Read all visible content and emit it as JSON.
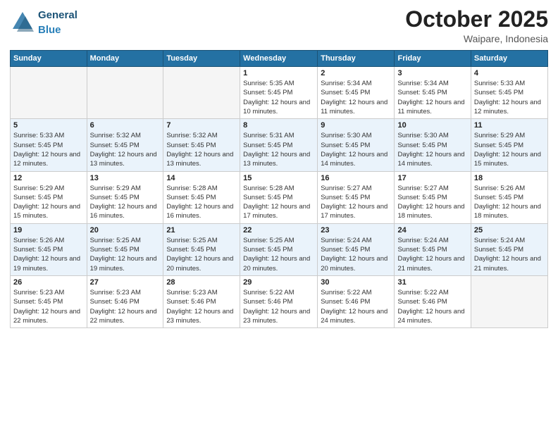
{
  "logo": {
    "general": "General",
    "blue": "Blue"
  },
  "header": {
    "month": "October 2025",
    "location": "Waipare, Indonesia"
  },
  "weekdays": [
    "Sunday",
    "Monday",
    "Tuesday",
    "Wednesday",
    "Thursday",
    "Friday",
    "Saturday"
  ],
  "weeks": [
    [
      {
        "day": "",
        "sunrise": "",
        "sunset": "",
        "daylight": ""
      },
      {
        "day": "",
        "sunrise": "",
        "sunset": "",
        "daylight": ""
      },
      {
        "day": "",
        "sunrise": "",
        "sunset": "",
        "daylight": ""
      },
      {
        "day": "1",
        "sunrise": "Sunrise: 5:35 AM",
        "sunset": "Sunset: 5:45 PM",
        "daylight": "Daylight: 12 hours and 10 minutes."
      },
      {
        "day": "2",
        "sunrise": "Sunrise: 5:34 AM",
        "sunset": "Sunset: 5:45 PM",
        "daylight": "Daylight: 12 hours and 11 minutes."
      },
      {
        "day": "3",
        "sunrise": "Sunrise: 5:34 AM",
        "sunset": "Sunset: 5:45 PM",
        "daylight": "Daylight: 12 hours and 11 minutes."
      },
      {
        "day": "4",
        "sunrise": "Sunrise: 5:33 AM",
        "sunset": "Sunset: 5:45 PM",
        "daylight": "Daylight: 12 hours and 12 minutes."
      }
    ],
    [
      {
        "day": "5",
        "sunrise": "Sunrise: 5:33 AM",
        "sunset": "Sunset: 5:45 PM",
        "daylight": "Daylight: 12 hours and 12 minutes."
      },
      {
        "day": "6",
        "sunrise": "Sunrise: 5:32 AM",
        "sunset": "Sunset: 5:45 PM",
        "daylight": "Daylight: 12 hours and 13 minutes."
      },
      {
        "day": "7",
        "sunrise": "Sunrise: 5:32 AM",
        "sunset": "Sunset: 5:45 PM",
        "daylight": "Daylight: 12 hours and 13 minutes."
      },
      {
        "day": "8",
        "sunrise": "Sunrise: 5:31 AM",
        "sunset": "Sunset: 5:45 PM",
        "daylight": "Daylight: 12 hours and 13 minutes."
      },
      {
        "day": "9",
        "sunrise": "Sunrise: 5:30 AM",
        "sunset": "Sunset: 5:45 PM",
        "daylight": "Daylight: 12 hours and 14 minutes."
      },
      {
        "day": "10",
        "sunrise": "Sunrise: 5:30 AM",
        "sunset": "Sunset: 5:45 PM",
        "daylight": "Daylight: 12 hours and 14 minutes."
      },
      {
        "day": "11",
        "sunrise": "Sunrise: 5:29 AM",
        "sunset": "Sunset: 5:45 PM",
        "daylight": "Daylight: 12 hours and 15 minutes."
      }
    ],
    [
      {
        "day": "12",
        "sunrise": "Sunrise: 5:29 AM",
        "sunset": "Sunset: 5:45 PM",
        "daylight": "Daylight: 12 hours and 15 minutes."
      },
      {
        "day": "13",
        "sunrise": "Sunrise: 5:29 AM",
        "sunset": "Sunset: 5:45 PM",
        "daylight": "Daylight: 12 hours and 16 minutes."
      },
      {
        "day": "14",
        "sunrise": "Sunrise: 5:28 AM",
        "sunset": "Sunset: 5:45 PM",
        "daylight": "Daylight: 12 hours and 16 minutes."
      },
      {
        "day": "15",
        "sunrise": "Sunrise: 5:28 AM",
        "sunset": "Sunset: 5:45 PM",
        "daylight": "Daylight: 12 hours and 17 minutes."
      },
      {
        "day": "16",
        "sunrise": "Sunrise: 5:27 AM",
        "sunset": "Sunset: 5:45 PM",
        "daylight": "Daylight: 12 hours and 17 minutes."
      },
      {
        "day": "17",
        "sunrise": "Sunrise: 5:27 AM",
        "sunset": "Sunset: 5:45 PM",
        "daylight": "Daylight: 12 hours and 18 minutes."
      },
      {
        "day": "18",
        "sunrise": "Sunrise: 5:26 AM",
        "sunset": "Sunset: 5:45 PM",
        "daylight": "Daylight: 12 hours and 18 minutes."
      }
    ],
    [
      {
        "day": "19",
        "sunrise": "Sunrise: 5:26 AM",
        "sunset": "Sunset: 5:45 PM",
        "daylight": "Daylight: 12 hours and 19 minutes."
      },
      {
        "day": "20",
        "sunrise": "Sunrise: 5:25 AM",
        "sunset": "Sunset: 5:45 PM",
        "daylight": "Daylight: 12 hours and 19 minutes."
      },
      {
        "day": "21",
        "sunrise": "Sunrise: 5:25 AM",
        "sunset": "Sunset: 5:45 PM",
        "daylight": "Daylight: 12 hours and 20 minutes."
      },
      {
        "day": "22",
        "sunrise": "Sunrise: 5:25 AM",
        "sunset": "Sunset: 5:45 PM",
        "daylight": "Daylight: 12 hours and 20 minutes."
      },
      {
        "day": "23",
        "sunrise": "Sunrise: 5:24 AM",
        "sunset": "Sunset: 5:45 PM",
        "daylight": "Daylight: 12 hours and 20 minutes."
      },
      {
        "day": "24",
        "sunrise": "Sunrise: 5:24 AM",
        "sunset": "Sunset: 5:45 PM",
        "daylight": "Daylight: 12 hours and 21 minutes."
      },
      {
        "day": "25",
        "sunrise": "Sunrise: 5:24 AM",
        "sunset": "Sunset: 5:45 PM",
        "daylight": "Daylight: 12 hours and 21 minutes."
      }
    ],
    [
      {
        "day": "26",
        "sunrise": "Sunrise: 5:23 AM",
        "sunset": "Sunset: 5:45 PM",
        "daylight": "Daylight: 12 hours and 22 minutes."
      },
      {
        "day": "27",
        "sunrise": "Sunrise: 5:23 AM",
        "sunset": "Sunset: 5:46 PM",
        "daylight": "Daylight: 12 hours and 22 minutes."
      },
      {
        "day": "28",
        "sunrise": "Sunrise: 5:23 AM",
        "sunset": "Sunset: 5:46 PM",
        "daylight": "Daylight: 12 hours and 23 minutes."
      },
      {
        "day": "29",
        "sunrise": "Sunrise: 5:22 AM",
        "sunset": "Sunset: 5:46 PM",
        "daylight": "Daylight: 12 hours and 23 minutes."
      },
      {
        "day": "30",
        "sunrise": "Sunrise: 5:22 AM",
        "sunset": "Sunset: 5:46 PM",
        "daylight": "Daylight: 12 hours and 24 minutes."
      },
      {
        "day": "31",
        "sunrise": "Sunrise: 5:22 AM",
        "sunset": "Sunset: 5:46 PM",
        "daylight": "Daylight: 12 hours and 24 minutes."
      },
      {
        "day": "",
        "sunrise": "",
        "sunset": "",
        "daylight": ""
      }
    ]
  ]
}
